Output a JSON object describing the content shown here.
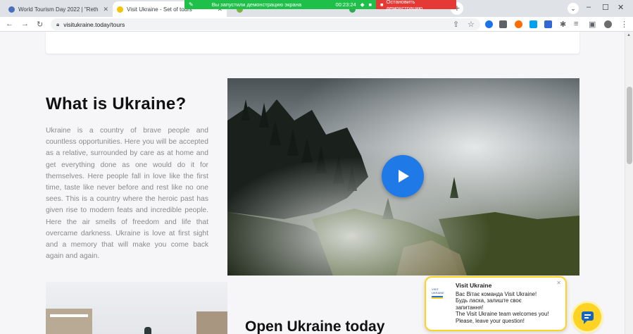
{
  "browser": {
    "tabs": [
      {
        "title": "World Tourism Day 2022 | \"Reth",
        "active": false,
        "favicon_color": "#4a6fbf"
      },
      {
        "title": "Visit Ukraine - Set of tours",
        "active": true,
        "favicon_color": "#f4c400"
      },
      {
        "title": "",
        "active": false,
        "favicon_color": "#7cb342"
      },
      {
        "title": "",
        "active": false,
        "favicon_color": "#34a853"
      }
    ],
    "url": "visitukraine.today/tours",
    "colors": {
      "tabstrip": "#dfe3e8",
      "share_green": "#1ec04a",
      "share_red": "#e53935"
    }
  },
  "screen_share": {
    "message": "Вы запустили демонстрацию экрана",
    "timer": "00:23:24",
    "stop_label": "Остановить демонстрацию"
  },
  "page": {
    "section_title": "What is Ukraine?",
    "section_text": "Ukraine is a country of brave people and countless opportunities. Here you will be accepted as a relative, surrounded by care as at home and get everything done as one would do it for themselves. Here people fall in love like the first time, taste like never before and rest like no one sees. This is a country where the heroic past has given rise to modern feats and incredible people. Here the air smells of freedom and life that overcame darkness. Ukraine is love at first sight and a memory that will make you come back again and again.",
    "video": {
      "play_icon": "play-icon",
      "accent": "#1f7ae8"
    },
    "next_section_title": "Open Ukraine today"
  },
  "chat": {
    "title": "Visit Ukraine",
    "lines": [
      "Вас Вітає команда Visit Ukraine!",
      "Будь ласка, залиште своє",
      "запитання!",
      "The Visit Ukraine team welcomes you!",
      "Please, leave your question!"
    ],
    "accent": "#ffd324"
  }
}
